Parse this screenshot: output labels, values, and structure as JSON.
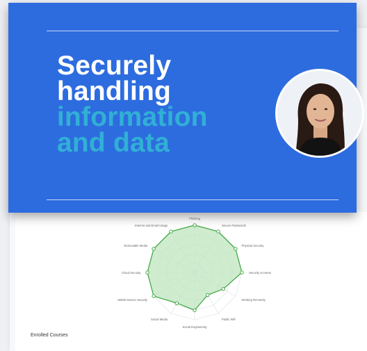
{
  "banner": {
    "title_line1": "Securely",
    "title_line2": "handling",
    "title_line3": "information",
    "title_line4": "and data",
    "avatar_icon": "presenter-avatar",
    "colors": {
      "background": "#2d6cdf",
      "accent": "#31b0d5"
    }
  },
  "section": {
    "enrolled_label": "Enrolled Courses"
  },
  "chart_data": {
    "type": "radar",
    "categories": [
      "Phishing",
      "Secure Passwords",
      "Physical Security",
      "Security at Home",
      "Working Remotely",
      "Public Wifi",
      "Social Engineering",
      "Social Media",
      "Mobile Device Security",
      "Cloud Security",
      "Removable Media",
      "Internet and Email Usage"
    ],
    "values": [
      100,
      100,
      100,
      100,
      70,
      55,
      80,
      75,
      100,
      100,
      100,
      100
    ],
    "ylim": [
      0,
      100
    ],
    "color": "#46a84a",
    "fill": "#bfe5bf"
  }
}
